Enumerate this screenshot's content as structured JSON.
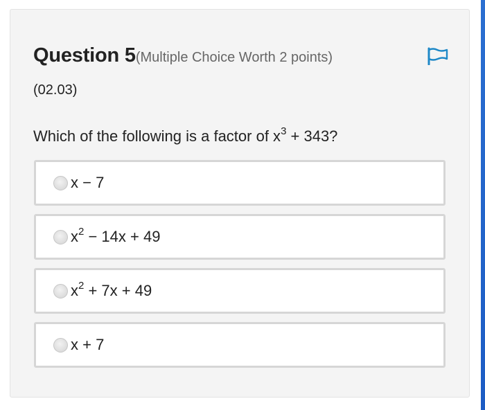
{
  "question": {
    "title": "Question 5",
    "meta": "(Multiple Choice Worth 2 points)",
    "code": "(02.03)",
    "prompt_prefix": "Which of the following is a factor of x",
    "prompt_exponent": "3",
    "prompt_suffix": " + 343?"
  },
  "flag": {
    "icon": "flag-icon",
    "color": "#1e88c7"
  },
  "options": [
    {
      "base": "x",
      "exponent": "",
      "rest": " − 7",
      "selected": false
    },
    {
      "base": "x",
      "exponent": "2",
      "rest": " − 14x + 49",
      "selected": false
    },
    {
      "base": "x",
      "exponent": "2",
      "rest": " + 7x + 49",
      "selected": false
    },
    {
      "base": "x",
      "exponent": "",
      "rest": " + 7",
      "selected": false
    }
  ],
  "colors": {
    "card_background": "#f4f4f4",
    "option_border": "#d6d6d6",
    "accent_edge": "#2b6fd1"
  }
}
